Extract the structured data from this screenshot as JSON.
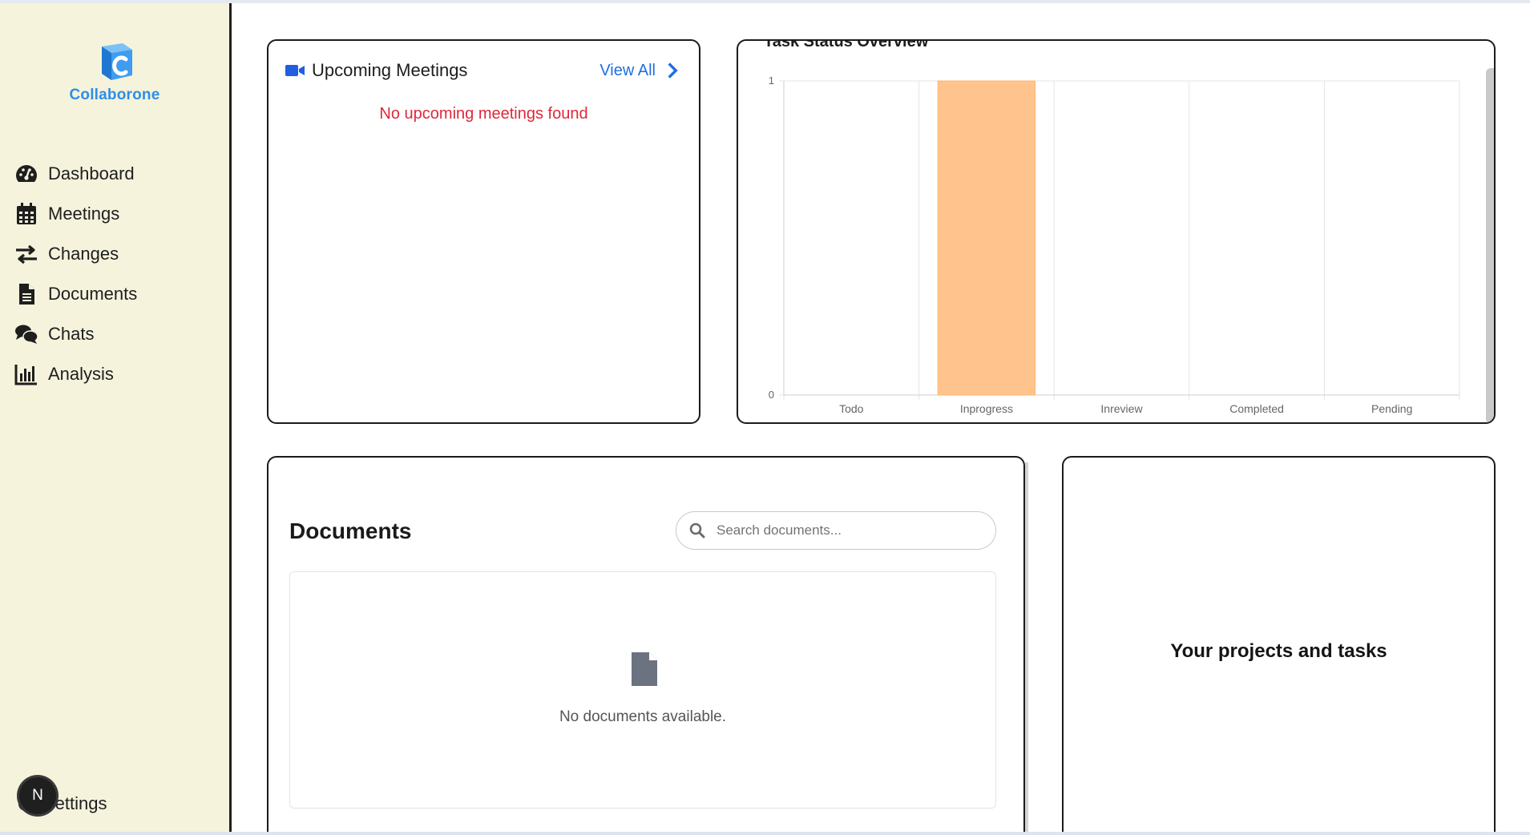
{
  "brand": {
    "name": "Collaborone",
    "color": "#2f8ee6"
  },
  "sidebar": {
    "items": [
      {
        "label": "Dashboard",
        "icon": "gauge-icon"
      },
      {
        "label": "Meetings",
        "icon": "calendar-icon"
      },
      {
        "label": "Changes",
        "icon": "arrows-swap-icon"
      },
      {
        "label": "Documents",
        "icon": "file-icon"
      },
      {
        "label": "Chats",
        "icon": "comments-icon"
      },
      {
        "label": "Analysis",
        "icon": "bar-chart-icon"
      }
    ],
    "settings_label": "Settings",
    "avatar_initial": "N"
  },
  "meetings": {
    "title": "Upcoming Meetings",
    "view_all": "View All",
    "empty": "No upcoming meetings found",
    "empty_color": "#e0283a"
  },
  "chart_data": {
    "type": "bar",
    "title": "Task Status Overview",
    "categories": [
      "Todo",
      "Inprogress",
      "Inreview",
      "Completed",
      "Pending"
    ],
    "values": [
      0,
      1,
      0,
      0,
      0
    ],
    "ylim": [
      0,
      1
    ],
    "yticks": [
      "0",
      "1"
    ],
    "xlabel": "",
    "ylabel": "",
    "bar_color": "#ffc48e",
    "grid": true
  },
  "documents": {
    "title": "Documents",
    "search_placeholder": "Search documents...",
    "empty": "No documents available."
  },
  "projects": {
    "title": "Your projects and tasks"
  }
}
